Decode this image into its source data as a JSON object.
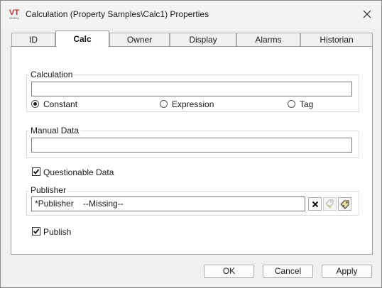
{
  "window": {
    "title": "Calculation (Property Samples\\Calc1) Properties",
    "logo_text": "VT",
    "logo_subtext": "SCADA"
  },
  "tabs": [
    {
      "label": "ID",
      "active": false
    },
    {
      "label": "Calc",
      "active": true
    },
    {
      "label": "Owner",
      "active": false
    },
    {
      "label": "Display",
      "active": false
    },
    {
      "label": "Alarms",
      "active": false
    },
    {
      "label": "Historian",
      "active": false
    }
  ],
  "calculation": {
    "group_label": "Calculation",
    "value": "",
    "options": [
      {
        "label": "Constant",
        "checked": true
      },
      {
        "label": "Expression",
        "checked": false
      },
      {
        "label": "Tag",
        "checked": false
      }
    ]
  },
  "manual_data": {
    "group_label": "Manual Data",
    "value": ""
  },
  "questionable_data": {
    "label": "Questionable Data",
    "checked": true
  },
  "publisher": {
    "group_label": "Publisher",
    "value": "*Publisher    --Missing--",
    "buttons": [
      "clear-icon",
      "tag-browse-icon",
      "tag-select-icon"
    ]
  },
  "publish": {
    "label": "Publish",
    "checked": true
  },
  "footer": {
    "ok_label": "OK",
    "cancel_label": "Cancel",
    "apply_label": "Apply"
  }
}
